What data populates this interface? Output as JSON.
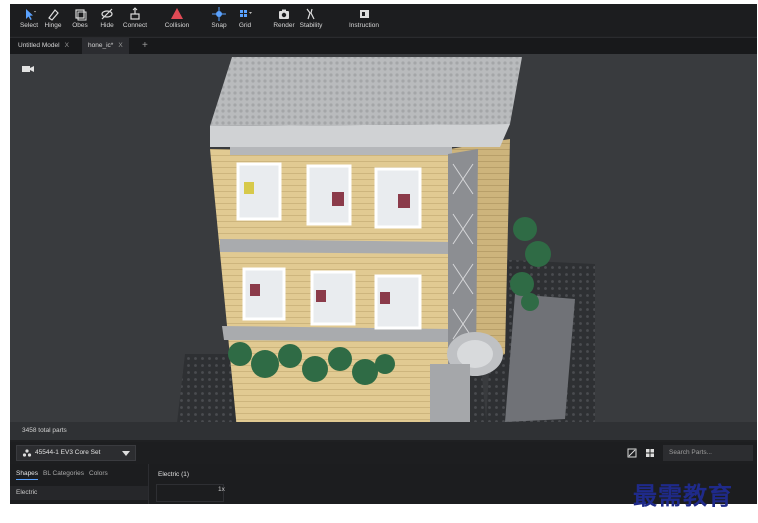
{
  "toolbar": {
    "tools": [
      {
        "label": "Select",
        "icon": "cursor-icon"
      },
      {
        "label": "Hinge",
        "icon": "hinge-icon"
      },
      {
        "label": "Obes",
        "icon": "layers-icon"
      },
      {
        "label": "Hide",
        "icon": "eye-slash-icon"
      },
      {
        "label": "Connect",
        "icon": "connect-icon"
      },
      {
        "label": "Collision",
        "icon": "collision-icon"
      },
      {
        "label": "Snap",
        "icon": "snap-icon"
      },
      {
        "label": "Grid",
        "icon": "grid-icon"
      },
      {
        "label": "Render",
        "icon": "camera-icon"
      },
      {
        "label": "Stability",
        "icon": "stability-icon"
      },
      {
        "label": "Instruction",
        "icon": "book-icon"
      }
    ]
  },
  "tabs": [
    {
      "label": "Untitled Model",
      "close": "X",
      "active": false
    },
    {
      "label": "hone_ic*",
      "close": "X",
      "active": true
    }
  ],
  "tab_add": "+",
  "viewport": {
    "status": "3458 total parts"
  },
  "setbar": {
    "set_name": "45544-1 EV3 Core Set",
    "search_placeholder": "Search Parts..."
  },
  "panel": {
    "tabs": [
      {
        "label": "Shapes",
        "active": true
      },
      {
        "label": "BL Categories",
        "active": false
      },
      {
        "label": "Colors",
        "active": false
      }
    ],
    "category": "Electric",
    "list_header": "Electric (1)",
    "count": "1x"
  },
  "watermark": "最需教育",
  "colors": {
    "toolbar_bg": "#1c1d1f",
    "viewport_bg": "#393b3e",
    "collision_red": "#e04a55",
    "accent_blue": "#5aa2ff",
    "brick_tan": "#e1ca92",
    "roof_gray": "#b9bbbd",
    "plant_green": "#2f6b45"
  }
}
